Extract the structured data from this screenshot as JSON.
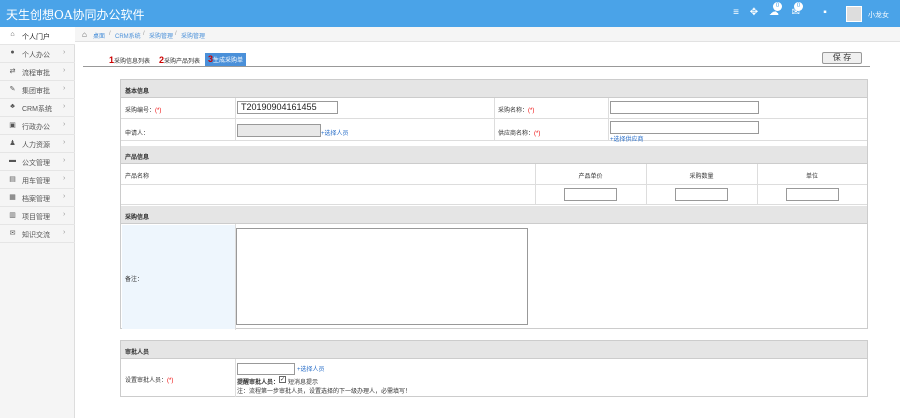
{
  "app": {
    "title": "天生创想OA协同办公软件",
    "user_name": "小龙女"
  },
  "header_icons": {
    "bubbles": [
      "0",
      "0"
    ]
  },
  "sidebar": {
    "items": [
      {
        "label": "个人门户",
        "icon": "home-icon",
        "glyph": "⌂"
      },
      {
        "label": "个人办公",
        "icon": "user-icon",
        "glyph": "●"
      },
      {
        "label": "流程审批",
        "icon": "flow-icon",
        "glyph": "⇄"
      },
      {
        "label": "集团审批",
        "icon": "approve-icon",
        "glyph": "✎"
      },
      {
        "label": "CRM系统",
        "icon": "group-icon",
        "glyph": "♣"
      },
      {
        "label": "行政办公",
        "icon": "office-icon",
        "glyph": "▣"
      },
      {
        "label": "人力资源",
        "icon": "people-icon",
        "glyph": "♟"
      },
      {
        "label": "公文管理",
        "icon": "folder-icon",
        "glyph": "▬"
      },
      {
        "label": "用车管理",
        "icon": "car-icon",
        "glyph": "▤"
      },
      {
        "label": "档案管理",
        "icon": "archive-icon",
        "glyph": "▦"
      },
      {
        "label": "项目管理",
        "icon": "project-icon",
        "glyph": "▥"
      },
      {
        "label": "知识交流",
        "icon": "comment-icon",
        "glyph": "✉"
      }
    ]
  },
  "breadcrumb": [
    "桌面",
    "CRM系统",
    "采购管理",
    "采购管理"
  ],
  "steps": [
    {
      "num": "1",
      "label": "采购信息列表"
    },
    {
      "num": "2",
      "label": "采购产品列表"
    },
    {
      "num": "3",
      "label": "生成采购单"
    }
  ],
  "toolbar": {
    "save_label": "保 存"
  },
  "form": {
    "basic": {
      "title": "基本信息",
      "purchase_no_label": "采购编号：",
      "purchase_no_value": "T20190904161455",
      "purchase_name_label": "采购名称：",
      "applicant_label": "申请人：",
      "select_person_link": "+选择人员",
      "supplier_label": "供应商名称：",
      "select_supplier_link": "+选择供应商",
      "required_mark": "(*)"
    },
    "product": {
      "title": "产品信息",
      "columns": [
        "产品名称",
        "产品单价",
        "采购数量",
        "单位"
      ]
    },
    "purchase": {
      "title": "采购信息",
      "remark_label": "备注："
    },
    "approver": {
      "title": "审批人员",
      "set_label": "设置审批人员：",
      "required_mark": "(*)",
      "select_person_link": "+选择人员",
      "remind_label": "提醒审批人员：",
      "sms_label": "短消息提示",
      "sms_checked": true,
      "note": "注：流程第一步审批人员，设置选择的下一级办理人，必需填写！"
    }
  }
}
